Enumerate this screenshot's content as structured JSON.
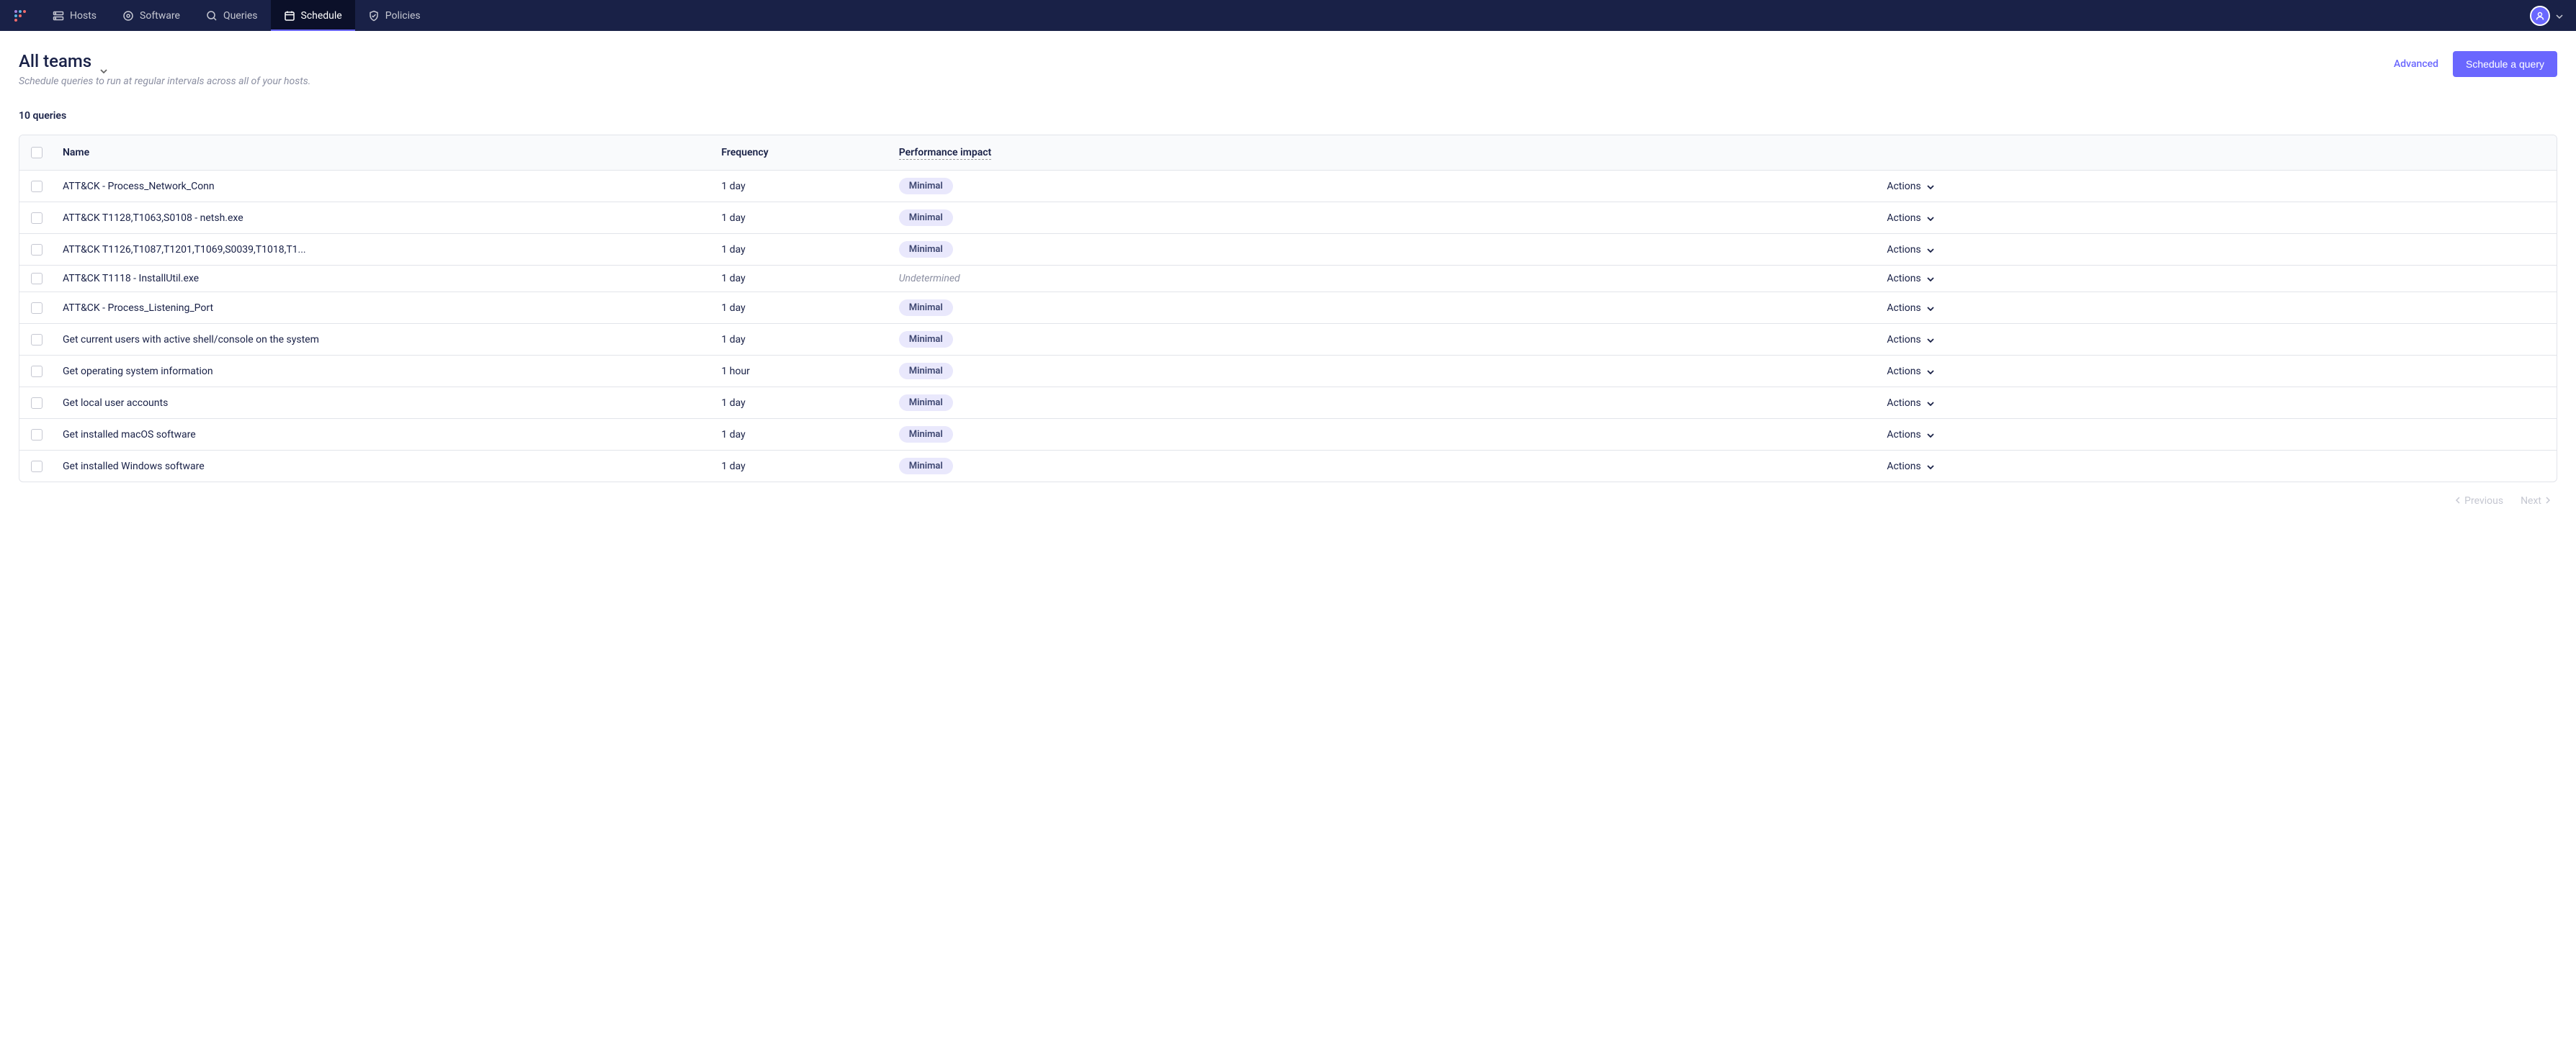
{
  "nav": {
    "items": [
      {
        "label": "Hosts"
      },
      {
        "label": "Software"
      },
      {
        "label": "Queries"
      },
      {
        "label": "Schedule"
      },
      {
        "label": "Policies"
      }
    ]
  },
  "page": {
    "title": "All teams",
    "subtitle_prefix": "Schedule queries to run at regular intervals across ",
    "subtitle_emphasis": "all of your hosts.",
    "advanced_label": "Advanced",
    "schedule_button": "Schedule a query",
    "count_label": "10 queries"
  },
  "table": {
    "headers": {
      "name": "Name",
      "frequency": "Frequency",
      "performance": "Performance impact"
    },
    "actions_label": "Actions",
    "rows": [
      {
        "name": "ATT&CK - Process_Network_Conn",
        "frequency": "1 day",
        "impact": "Minimal",
        "impact_type": "badge"
      },
      {
        "name": "ATT&CK T1128,T1063,S0108 - netsh.exe",
        "frequency": "1 day",
        "impact": "Minimal",
        "impact_type": "badge"
      },
      {
        "name": "ATT&CK T1126,T1087,T1201,T1069,S0039,T1018,T1...",
        "frequency": "1 day",
        "impact": "Minimal",
        "impact_type": "badge"
      },
      {
        "name": "ATT&CK T1118 - InstallUtil.exe",
        "frequency": "1 day",
        "impact": "Undetermined",
        "impact_type": "text"
      },
      {
        "name": "ATT&CK - Process_Listening_Port",
        "frequency": "1 day",
        "impact": "Minimal",
        "impact_type": "badge"
      },
      {
        "name": "Get current users with active shell/console on the system",
        "frequency": "1 day",
        "impact": "Minimal",
        "impact_type": "badge"
      },
      {
        "name": "Get operating system information",
        "frequency": "1 hour",
        "impact": "Minimal",
        "impact_type": "badge"
      },
      {
        "name": "Get local user accounts",
        "frequency": "1 day",
        "impact": "Minimal",
        "impact_type": "badge"
      },
      {
        "name": "Get installed macOS software",
        "frequency": "1 day",
        "impact": "Minimal",
        "impact_type": "badge"
      },
      {
        "name": "Get installed Windows software",
        "frequency": "1 day",
        "impact": "Minimal",
        "impact_type": "badge"
      }
    ]
  },
  "pagination": {
    "previous": "Previous",
    "next": "Next"
  }
}
